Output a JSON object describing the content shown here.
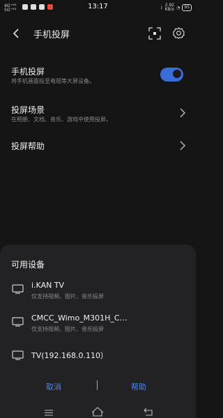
{
  "status": {
    "signal": "4G⁺ᴴᴰ\n5G⁺ᴴᴰ",
    "time": "13:17",
    "net_speed": "2.92\nKB/s",
    "battery": "95"
  },
  "header": {
    "title": "手机投屏"
  },
  "settings": [
    {
      "title": "手机投屏",
      "subtitle": "将手机画面投至电视等大屏设备。"
    },
    {
      "title": "投屏场景",
      "subtitle": "在相册、文档、音乐、游戏中使用投屏。"
    },
    {
      "title": "投屏帮助",
      "subtitle": ""
    }
  ],
  "toggle_on": true,
  "accent": "#3a6cd8",
  "dialog": {
    "title": "可用设备",
    "devices": [
      {
        "name": "i.KAN TV",
        "sub": "仅支持视频、图片、音乐投屏"
      },
      {
        "name": "CMCC_Wimo_M301H_C…",
        "sub": "仅支持视频、图片、音乐投屏"
      },
      {
        "name": "TV(192.168.0.110）",
        "sub": ""
      }
    ],
    "cancel": "取消",
    "help": "帮助"
  }
}
